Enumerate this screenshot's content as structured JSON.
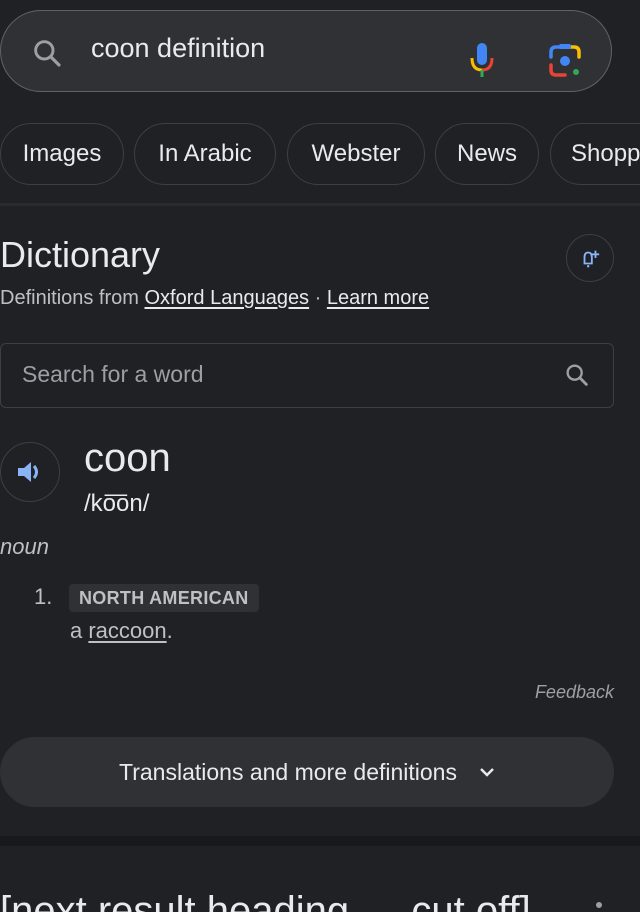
{
  "search": {
    "query": "coon definition",
    "icons": {
      "search": "search-icon",
      "voice": "microphone-icon",
      "lens": "google-lens-icon"
    }
  },
  "chips": [
    "Images",
    "In Arabic",
    "Webster",
    "News",
    "Shopp"
  ],
  "dictionary": {
    "title": "Dictionary",
    "source_prefix": "Definitions from ",
    "source_link": "Oxford Languages",
    "separator": " · ",
    "learn_more": "Learn more",
    "alert_icon": "bell-plus-icon",
    "word_search_placeholder": "Search for a word",
    "entry": {
      "word": "coon",
      "phonetic": "/ko͞on/",
      "part_of_speech": "noun",
      "senses": [
        {
          "number": "1.",
          "label": "NORTH AMERICAN",
          "definition_prefix": "a ",
          "definition_link": "raccoon",
          "definition_suffix": "."
        }
      ]
    },
    "feedback": "Feedback",
    "more_button": "Translations and more definitions"
  },
  "next_result": {
    "heading": "[next result heading — cut off]"
  },
  "colors": {
    "background": "#202124",
    "surface": "#303134",
    "text": "#e8eaed",
    "muted": "#bdc1c6",
    "accent_blue": "#8ab4f8"
  }
}
